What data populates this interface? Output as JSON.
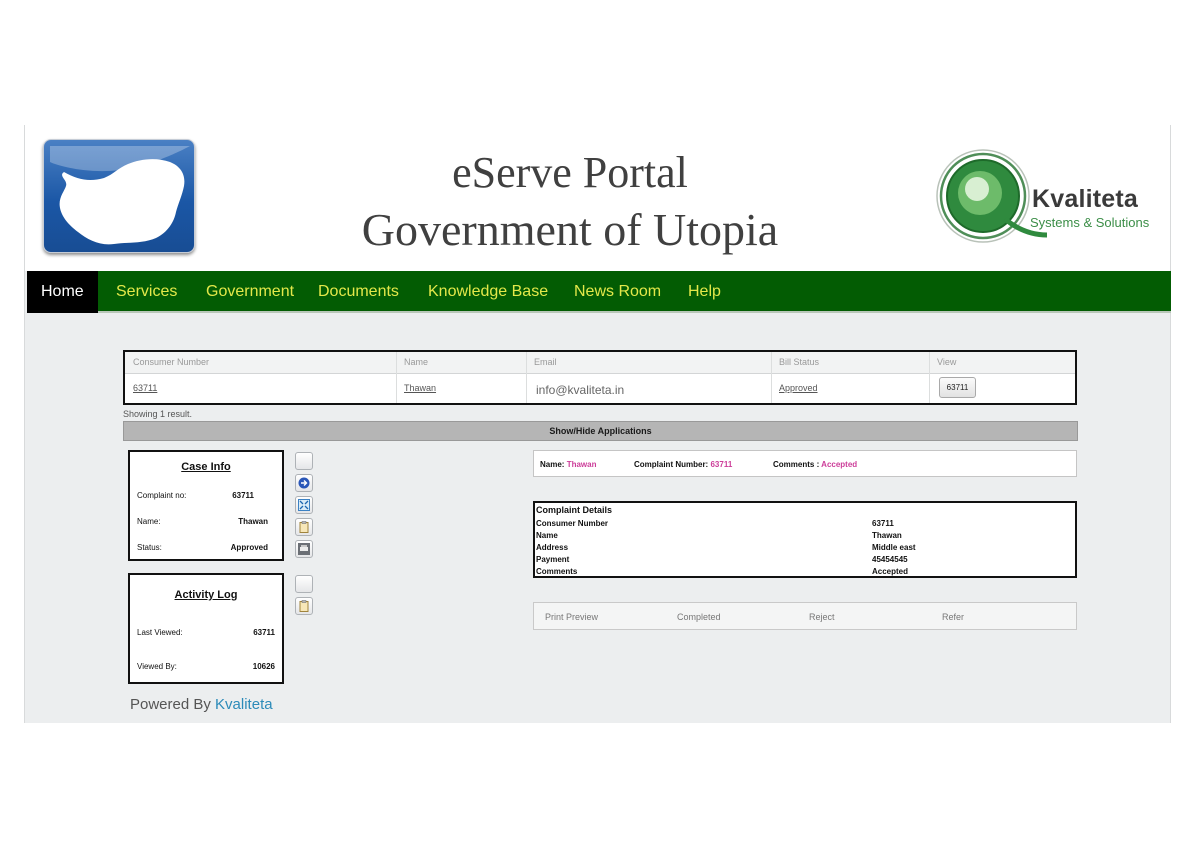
{
  "header": {
    "title_line1": "eServe Portal",
    "title_line2": "Government of Utopia",
    "logo_text": "Kvaliteta",
    "logo_sub": "Systems & Solutions",
    "logo_letter": "Q"
  },
  "nav": {
    "items": [
      "Home",
      "Services",
      "Government",
      "Documents",
      "Knowledge Base",
      "News Room",
      "Help"
    ],
    "active": "Home"
  },
  "results_table": {
    "headers": [
      "Consumer Number",
      "Name",
      "Email",
      "Bill Status",
      "View"
    ],
    "row": {
      "consumer_number": "63711",
      "name": "Thawan",
      "email": "info@kvaliteta.in",
      "bill_status": "Approved",
      "view_button": "63711"
    },
    "result_count": "Showing 1 result."
  },
  "show_hide_label": "Show/Hide Applications",
  "case_info": {
    "title": "Case Info",
    "fields": [
      {
        "label": "Complaint no:",
        "value": "63711"
      },
      {
        "label": "Name:",
        "value": "Thawan"
      },
      {
        "label": "Status:",
        "value": "Approved"
      }
    ]
  },
  "activity_log": {
    "title": "Activity Log",
    "fields": [
      {
        "label": "Last Viewed:",
        "value": "63711"
      },
      {
        "label": "Viewed By:",
        "value": "10626"
      }
    ]
  },
  "summary": {
    "name_label": "Name:",
    "name_value": "Thawan",
    "complaint_label": "Complaint Number:",
    "complaint_value": "63711",
    "comments_label": "Comments :",
    "comments_value": "Accepted"
  },
  "complaint_details": {
    "heading": "Complaint Details",
    "rows": [
      {
        "label": "Consumer Number",
        "value": "63711"
      },
      {
        "label": "Name",
        "value": "Thawan"
      },
      {
        "label": "Address",
        "value": "Middle east"
      },
      {
        "label": "Payment",
        "value": "45454545"
      },
      {
        "label": "Comments",
        "value": "Accepted"
      }
    ]
  },
  "actions": [
    "Print Preview",
    "Completed",
    "Reject",
    "Refer"
  ],
  "footer": {
    "powered_by": "Powered By",
    "brand": "Kvaliteta"
  },
  "colors": {
    "nav_bg": "#035c03",
    "nav_text": "#e3e84a",
    "highlight": "#cc3d99",
    "link": "#2c8bb9"
  }
}
